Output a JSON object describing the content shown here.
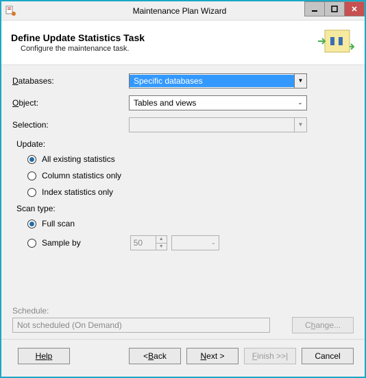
{
  "window": {
    "title": "Maintenance Plan Wizard"
  },
  "header": {
    "title": "Define Update Statistics Task",
    "subtitle": "Configure the maintenance task."
  },
  "fields": {
    "databases_label": "Databases:",
    "databases_value": "Specific databases",
    "object_label": "Object:",
    "object_value": "Tables and views",
    "selection_label": "Selection:",
    "selection_value": ""
  },
  "update": {
    "group_label": "Update:",
    "all": {
      "label": "All existing statistics",
      "selected": true
    },
    "column": {
      "label": "Column statistics only",
      "selected": false
    },
    "index": {
      "label": "Index statistics only",
      "selected": false
    }
  },
  "scan": {
    "group_label": "Scan type:",
    "full": {
      "label": "Full scan",
      "selected": true
    },
    "sample": {
      "label": "Sample by",
      "selected": false
    },
    "sample_value": "50",
    "sample_unit": ""
  },
  "schedule": {
    "label": "Schedule:",
    "value": "Not scheduled (On Demand)",
    "change_label": "Change..."
  },
  "buttons": {
    "help": "Help",
    "back": "< Back",
    "next": "Next >",
    "finish": "Finish >>|",
    "cancel": "Cancel"
  }
}
